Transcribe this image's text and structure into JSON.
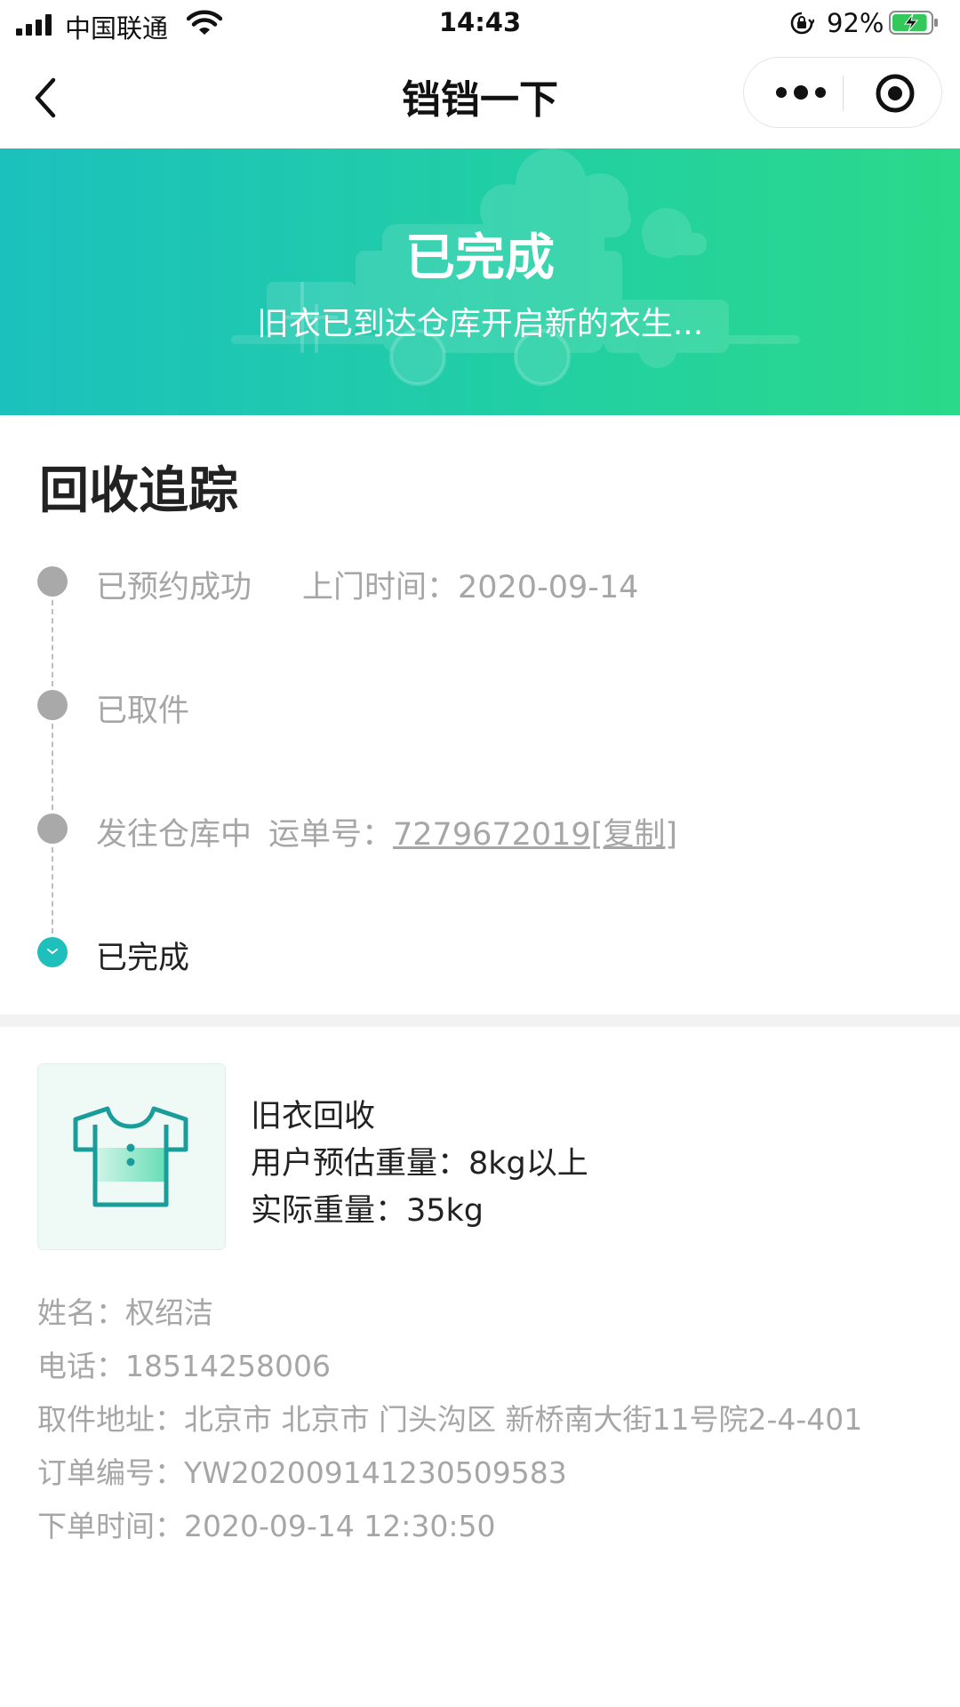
{
  "status_bar": {
    "carrier": "中国联通",
    "time": "14:43",
    "battery_percent": "92%",
    "battery_level": 0.92,
    "charging": true
  },
  "nav": {
    "title": "铛铛一下",
    "back_icon": "chevron-left-icon",
    "more_icon": "more-dots-icon",
    "close_icon": "target-circle-icon"
  },
  "banner": {
    "title": "已完成",
    "subtitle": "旧衣已到达仓库开启新的衣生...",
    "colors": {
      "start": "#1bc1bd",
      "end": "#2bd98a"
    }
  },
  "tracking": {
    "heading": "回收追踪",
    "steps": [
      {
        "label": "已预约成功",
        "extra": "上门时间：2020-09-14",
        "state": "done"
      },
      {
        "label": "已取件",
        "state": "done"
      },
      {
        "label": "发往仓库中",
        "waybill_label": "运单号：",
        "waybill": "7279672019[复制]",
        "state": "done"
      },
      {
        "label": "已完成",
        "state": "current"
      }
    ],
    "colors": {
      "inactive_dot": "#a9a9a9",
      "active_dot": "#1fbfbb"
    }
  },
  "product": {
    "icon": "tshirt-icon",
    "name": "旧衣回收",
    "estimated_weight": "用户预估重量：8kg以上",
    "actual_weight": "实际重量：35kg"
  },
  "order_info": {
    "name": "姓名：权绍洁",
    "phone": "电话：18514258006",
    "address": "取件地址：北京市 北京市 门头沟区 新桥南大街11号院2-4-401",
    "order_no": "订单编号：YW202009141230509583",
    "order_time": "下单时间：2020-09-14 12:30:50"
  }
}
